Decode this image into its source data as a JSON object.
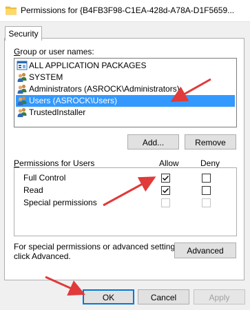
{
  "window": {
    "title": "Permissions for {B4FB3F98-C1EA-428d-A78A-D1F5659..."
  },
  "tabs": [
    {
      "label": "Security"
    }
  ],
  "group_section": {
    "label": "Group or user names:",
    "items": [
      {
        "label": "ALL APPLICATION PACKAGES",
        "icon": "app-packages-icon",
        "selected": false
      },
      {
        "label": "SYSTEM",
        "icon": "users-group-icon",
        "selected": false
      },
      {
        "label": "Administrators (ASROCK\\Administrators)",
        "icon": "users-group-icon",
        "selected": false
      },
      {
        "label": "Users (ASROCK\\Users)",
        "icon": "users-group-icon",
        "selected": true
      },
      {
        "label": "TrustedInstaller",
        "icon": "users-group-icon",
        "selected": false
      }
    ],
    "add_button": "Add...",
    "remove_button": "Remove"
  },
  "permissions_section": {
    "label": "Permissions for Users",
    "allow_header": "Allow",
    "deny_header": "Deny",
    "rows": [
      {
        "name": "Full Control",
        "allow": "checked",
        "deny": "unchecked"
      },
      {
        "name": "Read",
        "allow": "checked",
        "deny": "unchecked"
      },
      {
        "name": "Special permissions",
        "allow": "disabled",
        "deny": "disabled"
      }
    ]
  },
  "advanced_section": {
    "text_line1": "For special permissions or advanced settings,",
    "text_line2": "click Advanced.",
    "advanced_button": "Advanced"
  },
  "footer": {
    "ok_button": "OK",
    "cancel_button": "Cancel",
    "apply_button": "Apply"
  },
  "colors": {
    "selection": "#3399ff",
    "annotation_arrow": "#e03a3a"
  }
}
